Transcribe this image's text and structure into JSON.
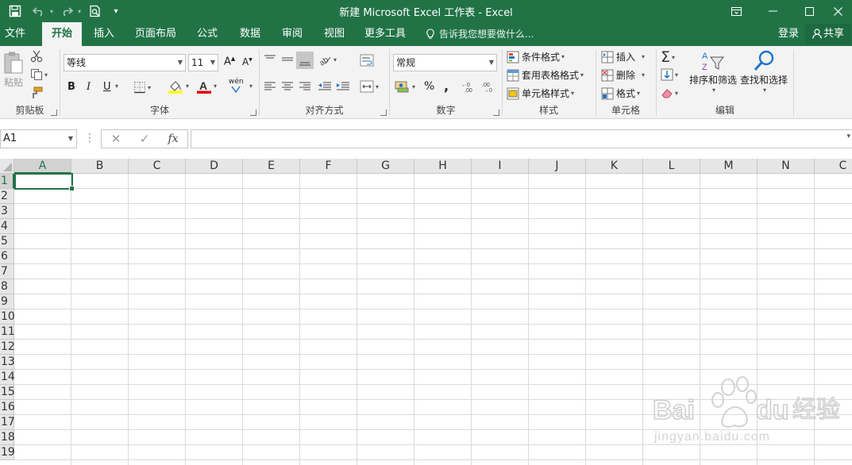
{
  "title_bar": {
    "title": "新建 Microsoft Excel 工作表 - Excel",
    "quick_access_more": "▾"
  },
  "tabs": [
    {
      "label": "文件"
    },
    {
      "label": "开始"
    },
    {
      "label": "插入"
    },
    {
      "label": "页面布局"
    },
    {
      "label": "公式"
    },
    {
      "label": "数据"
    },
    {
      "label": "审阅"
    },
    {
      "label": "视图"
    },
    {
      "label": "更多工具"
    }
  ],
  "tell_me": "告诉我您想要做什么...",
  "account": {
    "login": "登录",
    "share": "共享"
  },
  "ribbon": {
    "clipboard": {
      "label": "剪贴板",
      "paste": "粘贴"
    },
    "font": {
      "label": "字体",
      "font_name": "等线",
      "font_size": "11",
      "bold": "B",
      "italic": "I",
      "underline": "U",
      "font_color_letter": "A",
      "phonetic": "wén"
    },
    "alignment": {
      "label": "对齐方式"
    },
    "number": {
      "label": "数字",
      "format": "常规",
      "percent": "%",
      "comma": ","
    },
    "styles": {
      "label": "样式",
      "conditional": "条件格式",
      "table": "套用表格格式",
      "cell_styles": "单元格样式"
    },
    "cells": {
      "label": "单元格",
      "insert": "插入",
      "delete": "删除",
      "format": "格式"
    },
    "editing": {
      "label": "编辑",
      "sort_filter": "排序和筛选",
      "find_select": "查找和选择"
    }
  },
  "formula_bar": {
    "name_box": "A1",
    "fx": "fx",
    "formula": ""
  },
  "sheet": {
    "columns": [
      "A",
      "B",
      "C",
      "D",
      "E",
      "F",
      "G",
      "H",
      "I",
      "J",
      "K",
      "L",
      "M",
      "N",
      "C"
    ],
    "rows": [
      "1",
      "2",
      "3",
      "4",
      "5",
      "6",
      "7",
      "8",
      "9",
      "10",
      "11",
      "12",
      "13",
      "14",
      "15",
      "16",
      "17",
      "18",
      "19"
    ],
    "active_cell": "A1"
  },
  "colors": {
    "accent": "#217346",
    "ribbon_bg": "#f3f3f3",
    "grid_line": "#dadada",
    "header_bg": "#e6e6e6"
  }
}
